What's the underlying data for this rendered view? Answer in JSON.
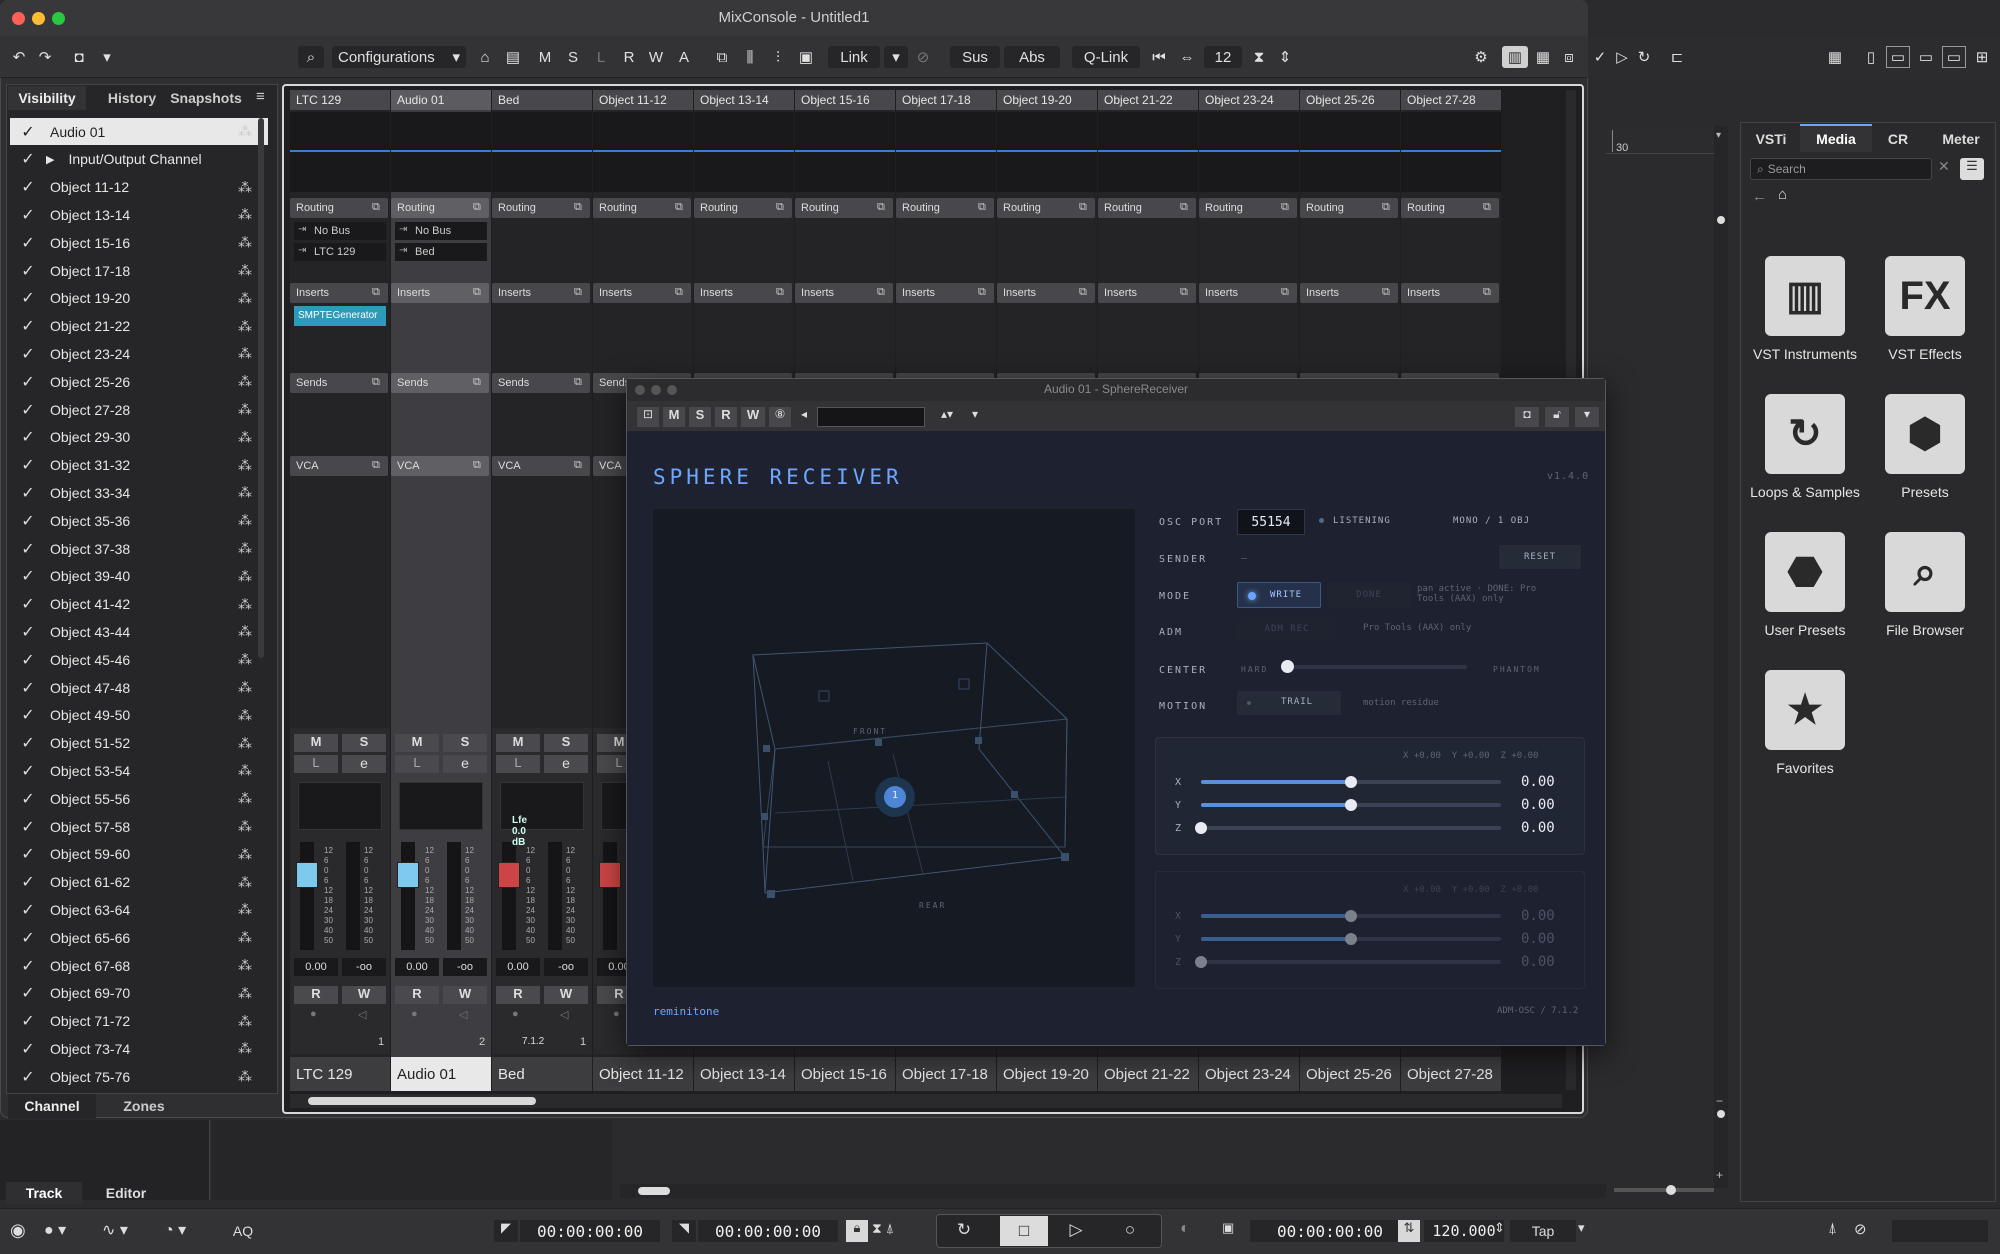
{
  "window": {
    "title": "MixConsole - Untitled1"
  },
  "toolbar": {
    "configurations": "Configurations",
    "m": "M",
    "s": "S",
    "l": "L",
    "r": "R",
    "w": "W",
    "a": "A",
    "link": "Link",
    "sus": "Sus",
    "abs": "Abs",
    "qlink": "Q-Link",
    "count": "12"
  },
  "left_tabs": {
    "visibility": "Visibility",
    "history": "History",
    "snapshots": "Snapshots"
  },
  "visibility_items": [
    "Audio 01",
    "Input/Output Channel",
    "Object 11-12",
    "Object 13-14",
    "Object 15-16",
    "Object 17-18",
    "Object 19-20",
    "Object 21-22",
    "Object 23-24",
    "Object 25-26",
    "Object 27-28",
    "Object 29-30",
    "Object 31-32",
    "Object 33-34",
    "Object 35-36",
    "Object 37-38",
    "Object 39-40",
    "Object 41-42",
    "Object 43-44",
    "Object 45-46",
    "Object 47-48",
    "Object 49-50",
    "Object 51-52",
    "Object 53-54",
    "Object 55-56",
    "Object 57-58",
    "Object 59-60",
    "Object 61-62",
    "Object 63-64",
    "Object 65-66",
    "Object 67-68",
    "Object 69-70",
    "Object 71-72",
    "Object 73-74",
    "Object 75-76"
  ],
  "left_bottom_tabs": {
    "channel": "Channel",
    "zones": "Zones"
  },
  "bottom_tabs": {
    "track": "Track",
    "editor": "Editor"
  },
  "channels": [
    "LTC 129",
    "Audio 01",
    "Bed",
    "Object 11-12",
    "Object 13-14",
    "Object 15-16",
    "Object 17-18",
    "Object 19-20",
    "Object 21-22",
    "Object 23-24",
    "Object 25-26",
    "Object 27-28"
  ],
  "sections": {
    "routing": "Routing",
    "inserts": "Inserts",
    "sends": "Sends",
    "vca": "VCA"
  },
  "routing": {
    "ltc_in": "No Bus",
    "ltc_out": "LTC 129",
    "a01_in": "No Bus",
    "a01_out": "Bed"
  },
  "insert_ltc": "SMPTEGenerator",
  "strip": {
    "m": "M",
    "s": "S",
    "l": "L",
    "e": "e",
    "r": "R",
    "w": "W",
    "vol": "0.00",
    "pan": "-oo",
    "lfe": "Lfe 0.0 dB",
    "num1": "1",
    "num2": "2",
    "num3": "1",
    "bed_fmt": "7.1.2"
  },
  "meter_scale": [
    "12",
    "6",
    "0",
    "6",
    "12",
    "18",
    "24",
    "30",
    "40",
    "50"
  ],
  "plugin": {
    "title": "Audio 01 - SphereReceiver",
    "name": "SPHERE RECEIVER",
    "version": "v1.4.0",
    "osc_port_label": "OSC PORT",
    "osc_port": "55154",
    "listening": "LISTENING",
    "mono": "MONO / 1 OBJ",
    "sender_label": "SENDER",
    "sender": "—",
    "reset": "RESET",
    "mode_label": "MODE",
    "write": "WRITE",
    "done": "DONE",
    "mode_note": "pan active · DONE: Pro Tools (AAX) only",
    "adm_label": "ADM",
    "adm_rec": "ADM REC",
    "adm_note": "Pro Tools (AAX) only",
    "center_label": "CENTER",
    "hard": "HARD",
    "phantom": "PHANTOM",
    "center_value": 0.0,
    "motion_label": "MOTION",
    "trail": "TRAIL",
    "motion_note": "motion residue",
    "front": "FRONT",
    "rear": "REAR",
    "object_id": "1",
    "xyz1_header": "X +0.00  Y +0.00  Z +0.00",
    "x_label": "X",
    "y_label": "Y",
    "z_label": "Z",
    "x_val": "0.00",
    "y_val": "0.00",
    "z_val": "0.00",
    "x_fill": 0.5,
    "y_fill": 0.5,
    "z_fill": 0.0,
    "xyz2_header": "X +0.00  Y +0.00  Z +0.00",
    "brand": "reminitone",
    "footer": "ADM-OSC / 7.1.2"
  },
  "right_tabs": {
    "vsti": "VSTi",
    "media": "Media",
    "cr": "CR",
    "meter": "Meter"
  },
  "search_placeholder": "Search",
  "media_items": [
    {
      "label": "VST Instruments",
      "icon": "piano-icon"
    },
    {
      "label": "VST Effects",
      "icon": "fx-icon"
    },
    {
      "label": "Loops & Samples",
      "icon": "loop-icon"
    },
    {
      "label": "Presets",
      "icon": "presets-icon"
    },
    {
      "label": "User Presets",
      "icon": "user-presets-icon"
    },
    {
      "label": "File Browser",
      "icon": "file-browser-icon"
    },
    {
      "label": "Favorites",
      "icon": "star-icon"
    }
  ],
  "ruler_mark": "30",
  "transport": {
    "time1": "00:00:00:00",
    "time2": "00:00:00:00",
    "time3": "00:00:00:00",
    "tempo": "120.000",
    "tap": "Tap",
    "aq": "AQ"
  }
}
